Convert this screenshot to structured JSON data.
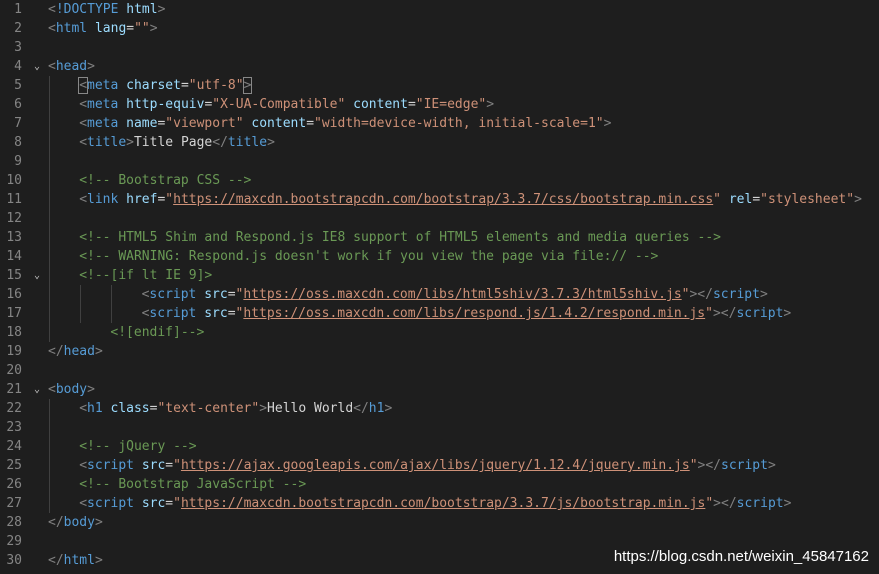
{
  "lines": [
    {
      "n": "1",
      "indent": 0,
      "tokens": [
        {
          "c": "t-br",
          "t": "<"
        },
        {
          "c": "t-tag",
          "t": "!DOCTYPE"
        },
        {
          "c": "t-txt",
          "t": " "
        },
        {
          "c": "t-attr",
          "t": "html"
        },
        {
          "c": "t-br",
          "t": ">"
        }
      ]
    },
    {
      "n": "2",
      "indent": 0,
      "tokens": [
        {
          "c": "t-br",
          "t": "<"
        },
        {
          "c": "t-tag",
          "t": "html"
        },
        {
          "c": "t-txt",
          "t": " "
        },
        {
          "c": "t-attr",
          "t": "lang"
        },
        {
          "c": "t-txt",
          "t": "="
        },
        {
          "c": "t-str",
          "t": "\"\""
        },
        {
          "c": "t-br",
          "t": ">"
        }
      ]
    },
    {
      "n": "3",
      "indent": 0,
      "tokens": []
    },
    {
      "n": "4",
      "indent": 0,
      "fold": true,
      "tokens": [
        {
          "c": "t-br",
          "t": "<"
        },
        {
          "c": "t-tag",
          "t": "head"
        },
        {
          "c": "t-br",
          "t": ">"
        }
      ]
    },
    {
      "n": "5",
      "indent": 1,
      "tokens": [
        {
          "c": "t-br bracket-match",
          "t": "<"
        },
        {
          "c": "t-tag",
          "t": "meta"
        },
        {
          "c": "t-txt",
          "t": " "
        },
        {
          "c": "t-attr",
          "t": "charset"
        },
        {
          "c": "t-txt",
          "t": "="
        },
        {
          "c": "t-str",
          "t": "\"utf-8\""
        },
        {
          "c": "t-br bracket-match",
          "t": ">"
        }
      ]
    },
    {
      "n": "6",
      "indent": 1,
      "tokens": [
        {
          "c": "t-br",
          "t": "<"
        },
        {
          "c": "t-tag",
          "t": "meta"
        },
        {
          "c": "t-txt",
          "t": " "
        },
        {
          "c": "t-attr",
          "t": "http-equiv"
        },
        {
          "c": "t-txt",
          "t": "="
        },
        {
          "c": "t-str",
          "t": "\"X-UA-Compatible\""
        },
        {
          "c": "t-txt",
          "t": " "
        },
        {
          "c": "t-attr",
          "t": "content"
        },
        {
          "c": "t-txt",
          "t": "="
        },
        {
          "c": "t-str",
          "t": "\"IE=edge\""
        },
        {
          "c": "t-br",
          "t": ">"
        }
      ]
    },
    {
      "n": "7",
      "indent": 1,
      "tokens": [
        {
          "c": "t-br",
          "t": "<"
        },
        {
          "c": "t-tag",
          "t": "meta"
        },
        {
          "c": "t-txt",
          "t": " "
        },
        {
          "c": "t-attr",
          "t": "name"
        },
        {
          "c": "t-txt",
          "t": "="
        },
        {
          "c": "t-str",
          "t": "\"viewport\""
        },
        {
          "c": "t-txt",
          "t": " "
        },
        {
          "c": "t-attr",
          "t": "content"
        },
        {
          "c": "t-txt",
          "t": "="
        },
        {
          "c": "t-str",
          "t": "\"width=device-width, initial-scale=1\""
        },
        {
          "c": "t-br",
          "t": ">"
        }
      ]
    },
    {
      "n": "8",
      "indent": 1,
      "tokens": [
        {
          "c": "t-br",
          "t": "<"
        },
        {
          "c": "t-tag",
          "t": "title"
        },
        {
          "c": "t-br",
          "t": ">"
        },
        {
          "c": "t-txt",
          "t": "Title Page"
        },
        {
          "c": "t-br",
          "t": "</"
        },
        {
          "c": "t-tag",
          "t": "title"
        },
        {
          "c": "t-br",
          "t": ">"
        }
      ]
    },
    {
      "n": "9",
      "indent": 1,
      "tokens": []
    },
    {
      "n": "10",
      "indent": 1,
      "tokens": [
        {
          "c": "t-com",
          "t": "<!-- Bootstrap CSS -->"
        }
      ]
    },
    {
      "n": "11",
      "indent": 1,
      "tokens": [
        {
          "c": "t-br",
          "t": "<"
        },
        {
          "c": "t-tag",
          "t": "link"
        },
        {
          "c": "t-txt",
          "t": " "
        },
        {
          "c": "t-attr",
          "t": "href"
        },
        {
          "c": "t-txt",
          "t": "="
        },
        {
          "c": "t-str",
          "t": "\""
        },
        {
          "c": "t-url",
          "t": "https://maxcdn.bootstrapcdn.com/bootstrap/3.3.7/css/bootstrap.min.css"
        },
        {
          "c": "t-str",
          "t": "\""
        },
        {
          "c": "t-txt",
          "t": " "
        },
        {
          "c": "t-attr",
          "t": "rel"
        },
        {
          "c": "t-txt",
          "t": "="
        },
        {
          "c": "t-str",
          "t": "\"stylesheet\""
        },
        {
          "c": "t-br",
          "t": ">"
        }
      ]
    },
    {
      "n": "12",
      "indent": 1,
      "tokens": []
    },
    {
      "n": "13",
      "indent": 1,
      "tokens": [
        {
          "c": "t-com",
          "t": "<!-- HTML5 Shim and Respond.js IE8 support of HTML5 elements and media queries -->"
        }
      ]
    },
    {
      "n": "14",
      "indent": 1,
      "tokens": [
        {
          "c": "t-com",
          "t": "<!-- WARNING: Respond.js doesn't work if you view the page via file:// -->"
        }
      ]
    },
    {
      "n": "15",
      "indent": 1,
      "fold": true,
      "tokens": [
        {
          "c": "t-com",
          "t": "<!--[if lt IE 9]>"
        }
      ]
    },
    {
      "n": "16",
      "indent": 3,
      "tokens": [
        {
          "c": "t-br",
          "t": "<"
        },
        {
          "c": "t-tag",
          "t": "script"
        },
        {
          "c": "t-txt",
          "t": " "
        },
        {
          "c": "t-attr",
          "t": "src"
        },
        {
          "c": "t-txt",
          "t": "="
        },
        {
          "c": "t-str",
          "t": "\""
        },
        {
          "c": "t-url",
          "t": "https://oss.maxcdn.com/libs/html5shiv/3.7.3/html5shiv.js"
        },
        {
          "c": "t-str",
          "t": "\""
        },
        {
          "c": "t-br",
          "t": "></"
        },
        {
          "c": "t-tag",
          "t": "script"
        },
        {
          "c": "t-br",
          "t": ">"
        }
      ]
    },
    {
      "n": "17",
      "indent": 3,
      "tokens": [
        {
          "c": "t-br",
          "t": "<"
        },
        {
          "c": "t-tag",
          "t": "script"
        },
        {
          "c": "t-txt",
          "t": " "
        },
        {
          "c": "t-attr",
          "t": "src"
        },
        {
          "c": "t-txt",
          "t": "="
        },
        {
          "c": "t-str",
          "t": "\""
        },
        {
          "c": "t-url",
          "t": "https://oss.maxcdn.com/libs/respond.js/1.4.2/respond.min.js"
        },
        {
          "c": "t-str",
          "t": "\""
        },
        {
          "c": "t-br",
          "t": "></"
        },
        {
          "c": "t-tag",
          "t": "script"
        },
        {
          "c": "t-br",
          "t": ">"
        }
      ]
    },
    {
      "n": "18",
      "indent": 2,
      "tokens": [
        {
          "c": "t-com",
          "t": "<![endif]-->"
        }
      ]
    },
    {
      "n": "19",
      "indent": 0,
      "tokens": [
        {
          "c": "t-br",
          "t": "</"
        },
        {
          "c": "t-tag",
          "t": "head"
        },
        {
          "c": "t-br",
          "t": ">"
        }
      ]
    },
    {
      "n": "20",
      "indent": 0,
      "tokens": []
    },
    {
      "n": "21",
      "indent": 0,
      "fold": true,
      "tokens": [
        {
          "c": "t-br",
          "t": "<"
        },
        {
          "c": "t-tag",
          "t": "body"
        },
        {
          "c": "t-br",
          "t": ">"
        }
      ]
    },
    {
      "n": "22",
      "indent": 1,
      "tokens": [
        {
          "c": "t-br",
          "t": "<"
        },
        {
          "c": "t-tag",
          "t": "h1"
        },
        {
          "c": "t-txt",
          "t": " "
        },
        {
          "c": "t-attr",
          "t": "class"
        },
        {
          "c": "t-txt",
          "t": "="
        },
        {
          "c": "t-str",
          "t": "\"text-center\""
        },
        {
          "c": "t-br",
          "t": ">"
        },
        {
          "c": "t-txt",
          "t": "Hello World"
        },
        {
          "c": "t-br",
          "t": "</"
        },
        {
          "c": "t-tag",
          "t": "h1"
        },
        {
          "c": "t-br",
          "t": ">"
        }
      ]
    },
    {
      "n": "23",
      "indent": 1,
      "tokens": []
    },
    {
      "n": "24",
      "indent": 1,
      "tokens": [
        {
          "c": "t-com",
          "t": "<!-- jQuery -->"
        }
      ]
    },
    {
      "n": "25",
      "indent": 1,
      "tokens": [
        {
          "c": "t-br",
          "t": "<"
        },
        {
          "c": "t-tag",
          "t": "script"
        },
        {
          "c": "t-txt",
          "t": " "
        },
        {
          "c": "t-attr",
          "t": "src"
        },
        {
          "c": "t-txt",
          "t": "="
        },
        {
          "c": "t-str",
          "t": "\""
        },
        {
          "c": "t-url",
          "t": "https://ajax.googleapis.com/ajax/libs/jquery/1.12.4/jquery.min.js"
        },
        {
          "c": "t-str",
          "t": "\""
        },
        {
          "c": "t-br",
          "t": "></"
        },
        {
          "c": "t-tag",
          "t": "script"
        },
        {
          "c": "t-br",
          "t": ">"
        }
      ]
    },
    {
      "n": "26",
      "indent": 1,
      "tokens": [
        {
          "c": "t-com",
          "t": "<!-- Bootstrap JavaScript -->"
        }
      ]
    },
    {
      "n": "27",
      "indent": 1,
      "tokens": [
        {
          "c": "t-br",
          "t": "<"
        },
        {
          "c": "t-tag",
          "t": "script"
        },
        {
          "c": "t-txt",
          "t": " "
        },
        {
          "c": "t-attr",
          "t": "src"
        },
        {
          "c": "t-txt",
          "t": "="
        },
        {
          "c": "t-str",
          "t": "\""
        },
        {
          "c": "t-url",
          "t": "https://maxcdn.bootstrapcdn.com/bootstrap/3.3.7/js/bootstrap.min.js"
        },
        {
          "c": "t-str",
          "t": "\""
        },
        {
          "c": "t-br",
          "t": "></"
        },
        {
          "c": "t-tag",
          "t": "script"
        },
        {
          "c": "t-br",
          "t": ">"
        }
      ]
    },
    {
      "n": "28",
      "indent": 0,
      "tokens": [
        {
          "c": "t-br",
          "t": "</"
        },
        {
          "c": "t-tag",
          "t": "body"
        },
        {
          "c": "t-br",
          "t": ">"
        }
      ]
    },
    {
      "n": "29",
      "indent": 0,
      "tokens": []
    },
    {
      "n": "30",
      "indent": 0,
      "tokens": [
        {
          "c": "t-br",
          "t": "</"
        },
        {
          "c": "t-tag",
          "t": "html"
        },
        {
          "c": "t-br",
          "t": ">"
        }
      ]
    }
  ],
  "watermark": "https://blog.csdn.net/weixin_45847162",
  "colors": {
    "background": "#1e1e1e",
    "tag": "#569cd6",
    "attribute": "#9cdcfe",
    "string": "#ce9178",
    "comment": "#6a9955",
    "line_number": "#858585"
  }
}
